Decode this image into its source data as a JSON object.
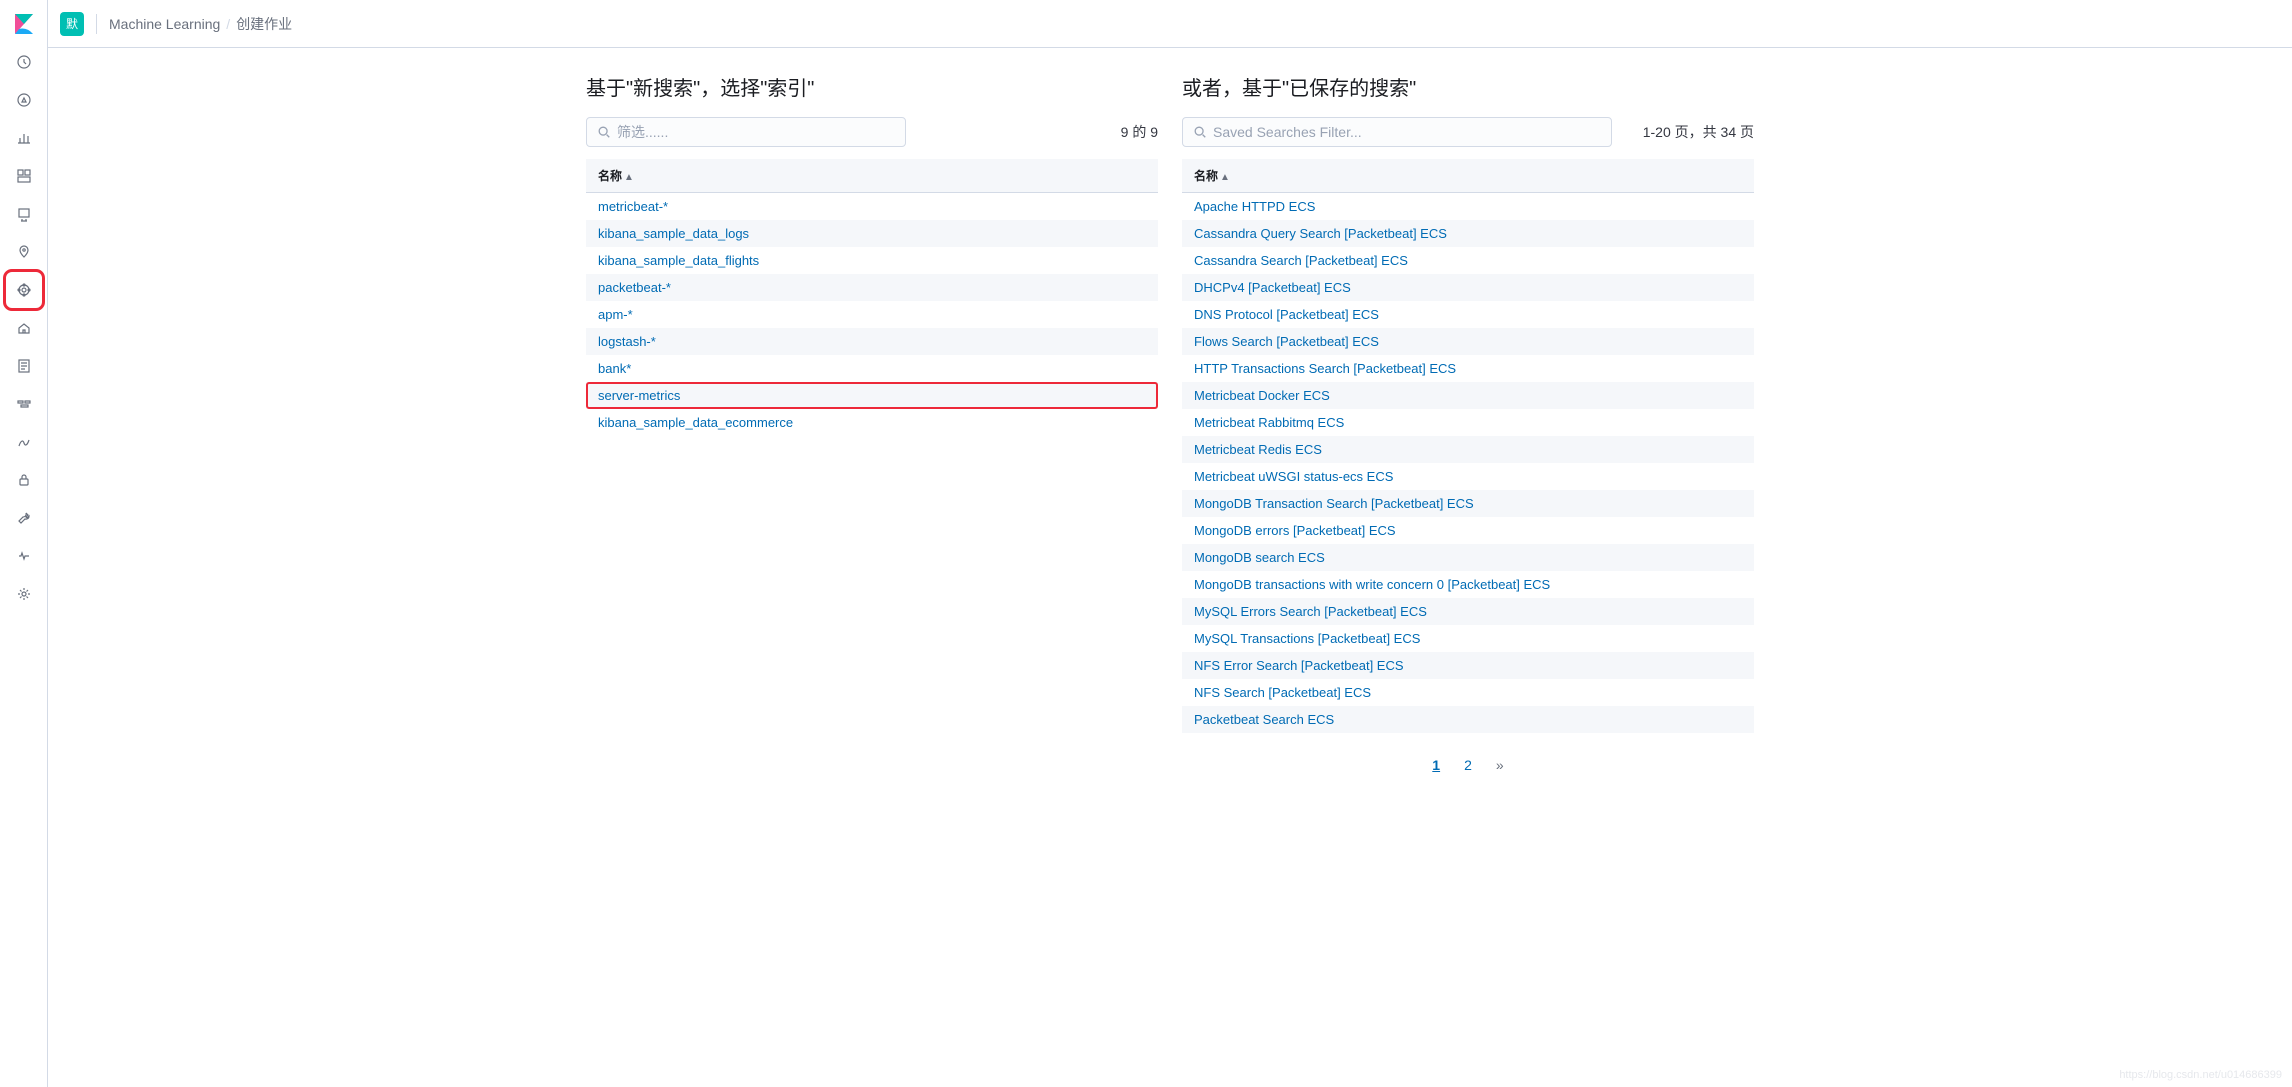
{
  "topbar": {
    "space_label": "默",
    "breadcrumb_app": "Machine Learning",
    "breadcrumb_page": "创建作业"
  },
  "left_panel": {
    "title": "基于\"新搜索\"，选择\"索引\"",
    "filter_placeholder": "筛选......",
    "count_text": "9 的 9",
    "column_header": "名称",
    "items": [
      "metricbeat-*",
      "kibana_sample_data_logs",
      "kibana_sample_data_flights",
      "packetbeat-*",
      "apm-*",
      "logstash-*",
      "bank*",
      "server-metrics",
      "kibana_sample_data_ecommerce"
    ],
    "highlighted_index": 7
  },
  "right_panel": {
    "title": "或者，基于\"已保存的搜索\"",
    "filter_placeholder": "Saved Searches Filter...",
    "count_text": "1-20 页，共 34 页",
    "column_header": "名称",
    "items": [
      "Apache HTTPD ECS",
      "Cassandra Query Search [Packetbeat] ECS",
      "Cassandra Search [Packetbeat] ECS",
      "DHCPv4 [Packetbeat] ECS",
      "DNS Protocol [Packetbeat] ECS",
      "Flows Search [Packetbeat] ECS",
      "HTTP Transactions Search [Packetbeat] ECS",
      "Metricbeat Docker ECS",
      "Metricbeat Rabbitmq ECS",
      "Metricbeat Redis ECS",
      "Metricbeat uWSGI status-ecs ECS",
      "MongoDB Transaction Search [Packetbeat] ECS",
      "MongoDB errors [Packetbeat] ECS",
      "MongoDB search ECS",
      "MongoDB transactions with write concern 0 [Packetbeat] ECS",
      "MySQL Errors Search [Packetbeat] ECS",
      "MySQL Transactions [Packetbeat] ECS",
      "NFS Error Search [Packetbeat] ECS",
      "NFS Search [Packetbeat] ECS",
      "Packetbeat Search ECS"
    ]
  },
  "pagination": {
    "pages": [
      "1",
      "2"
    ],
    "active": 0,
    "next": "»"
  },
  "watermark": "https://blog.csdn.net/u014686399"
}
